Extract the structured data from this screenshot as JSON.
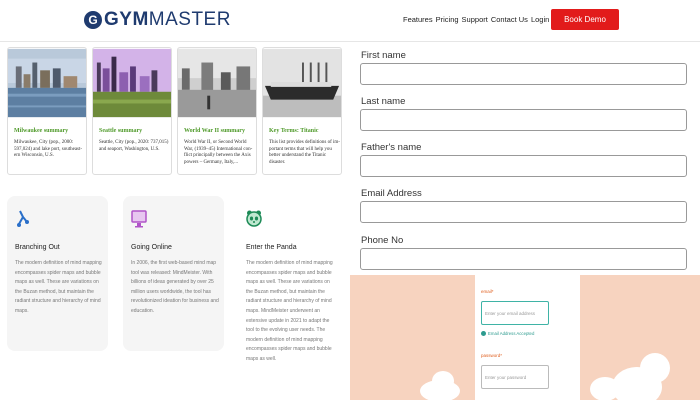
{
  "header": {
    "logo_mark": "G",
    "logo_text_bold": "GYM",
    "logo_text_light": "MASTER",
    "nav": [
      "Features",
      "Pricing",
      "Support",
      "Contact Us",
      "Login"
    ],
    "book_demo": "Book Demo"
  },
  "summaries": [
    {
      "title": "Milwaukee summary",
      "text": "Milwaukee, City (pop., 2000: 597,024) and lake port, southeast-ern Wisconsin, U.S."
    },
    {
      "title": "Seattle summary",
      "text": "Seattle, City (pop., 2020: 737,015) and seaport, Washington, U.S."
    },
    {
      "title": "World War II summary",
      "text": "World War II, or Second World War, (1939–45) International con-flict principally between the Axis powers – Germany, Italy,..."
    },
    {
      "title": "Key Terms: Titanic",
      "text": "This list provides definitions of im-portant terms that will help you better understand the Titanic disaster."
    }
  ],
  "features": [
    {
      "icon": "branching-icon",
      "title": "Branching Out",
      "text": "The modern definition of mind mapping encompasses spider maps and bubble maps as well. These are variations on the Buzan method, but maintain the radiant structure and hierarchy of mind maps."
    },
    {
      "icon": "monitor-icon",
      "title": "Going Online",
      "text": "In 2006, the first web-based mind map tool was released: MindMeister. With billions of ideas generated by over 25 million users worldwide, the tool has revolutionized ideation for business and education."
    },
    {
      "icon": "panda-icon",
      "title": "Enter the Panda",
      "text": "The modern definition of mind mapping encompasses spider maps and bubble maps as well. These are variations on the Buzan method, but maintain the radiant structure and hierarchy of mind maps. MindMeister underwent an extensive update in 2021 to adapt the tool to the evolving user needs. The modern definition of mind mapping encompasses spider maps and bubble maps as well."
    }
  ],
  "form": {
    "first_name": "First name",
    "last_name": "Last name",
    "fathers_name": "Father's name",
    "email": "Email Address",
    "phone": "Phone No"
  },
  "login": {
    "email_label": "email*",
    "email_placeholder": "Enter your email address",
    "email_note": "Email Address Accepted",
    "password_label": "password*",
    "password_placeholder": "Enter your password"
  },
  "colors": {
    "brand": "#1f3b6f",
    "cta": "#e21b1b",
    "summary_title": "#4f9a2a",
    "peach": "#f7d3bf",
    "accent_teal": "#3fb3a6"
  }
}
